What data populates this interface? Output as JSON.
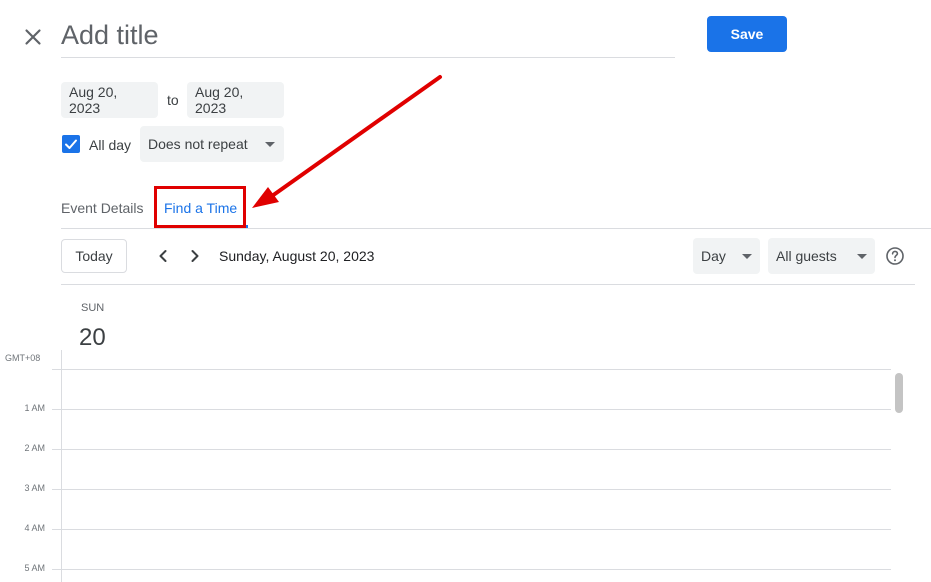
{
  "header": {
    "title_placeholder": "Add title",
    "save_label": "Save"
  },
  "dates": {
    "start": "Aug 20, 2023",
    "separator": "to",
    "end": "Aug 20, 2023"
  },
  "options": {
    "all_day_label": "All day",
    "all_day_checked": true,
    "repeat": "Does not repeat"
  },
  "tabs": [
    {
      "label": "Event Details",
      "active": false
    },
    {
      "label": "Find a Time",
      "active": true
    }
  ],
  "toolbar": {
    "today_label": "Today",
    "date_heading": "Sunday, August 20, 2023",
    "view": "Day",
    "guests_filter": "All guests"
  },
  "day": {
    "abbr": "SUN",
    "number": "20"
  },
  "timezone": "GMT+08",
  "hours": [
    "1 AM",
    "2 AM",
    "3 AM",
    "4 AM",
    "5 AM"
  ],
  "colors": {
    "accent": "#1a73e8",
    "annotation": "#e00000",
    "divider": "#dadce0"
  },
  "icons": {
    "close": "close-icon",
    "prev": "chevron-left-icon",
    "next": "chevron-right-icon",
    "help": "help-icon",
    "check": "check-icon",
    "dropdown": "arrow-drop-down-icon"
  }
}
